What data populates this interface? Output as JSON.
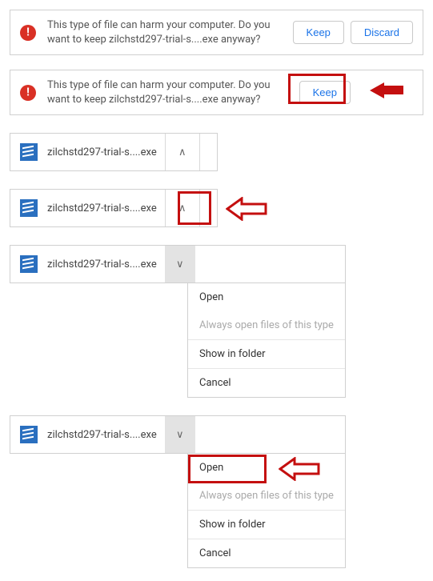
{
  "warning": {
    "text": "This type of file can harm your computer. Do you want to keep zilchstd297-trial-s....exe anyway?",
    "keep_label": "Keep",
    "discard_label": "Discard"
  },
  "download": {
    "filename": "zilchstd297-trial-s....exe"
  },
  "menu": {
    "open": "Open",
    "always_open": "Always open files of this type",
    "show_in_folder": "Show in folder",
    "cancel": "Cancel"
  },
  "colors": {
    "highlight": "#c40f0f",
    "link": "#1a73e8",
    "danger": "#d93025"
  }
}
